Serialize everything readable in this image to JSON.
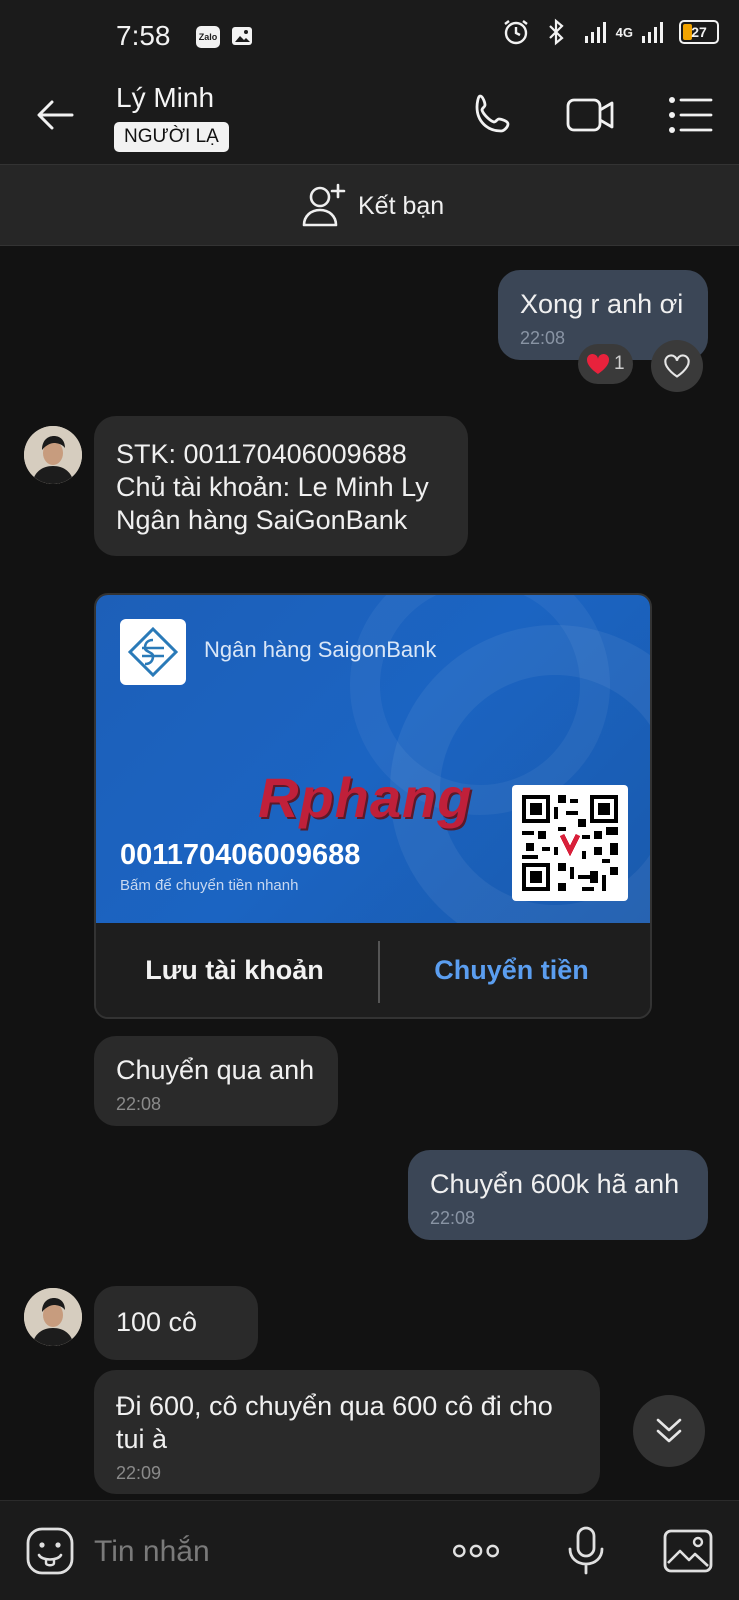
{
  "status_bar": {
    "time": "7:58",
    "app_badge": "Zalo",
    "network": "4G",
    "battery": "27"
  },
  "header": {
    "contact_name": "Lý Minh",
    "badge": "NGƯỜI LẠ"
  },
  "add_friend": {
    "label": "Kết bạn"
  },
  "messages": [
    {
      "id": "m1",
      "direction": "out",
      "text": "Xong r anh ơi",
      "time": "22:08",
      "reaction_count": "1"
    },
    {
      "id": "m2",
      "direction": "in",
      "lines": [
        "STK: 001170406009688",
        "Chủ tài khoản: Le Minh Ly",
        "Ngân hàng SaiGonBank"
      ]
    },
    {
      "id": "m4",
      "direction": "in",
      "text": "Chuyển qua anh",
      "time": "22:08"
    },
    {
      "id": "m5",
      "direction": "out",
      "text": "Chuyển 600k hã anh",
      "time": "22:08"
    },
    {
      "id": "m6",
      "direction": "in",
      "text": "100 cô"
    },
    {
      "id": "m7",
      "direction": "in",
      "lines": [
        "Đi 600, cô chuyển qua 600 cô đi cho",
        "tui à"
      ],
      "time": "22:09"
    }
  ],
  "bank_card": {
    "bank_name": "Ngân hàng SaigonBank",
    "watermark": "Rphang",
    "account_number": "001170406009688",
    "hint": "Bấm để chuyển tiền nhanh",
    "save_label": "Lưu tài khoản",
    "transfer_label": "Chuyển tiền",
    "card_color": "#1b64c2",
    "transfer_color": "#5b9ef0"
  },
  "composer": {
    "placeholder": "Tin nhắn"
  },
  "colors": {
    "background": "#121212",
    "incoming_bubble": "#2a2a2a",
    "outgoing_bubble": "#3b4656"
  }
}
